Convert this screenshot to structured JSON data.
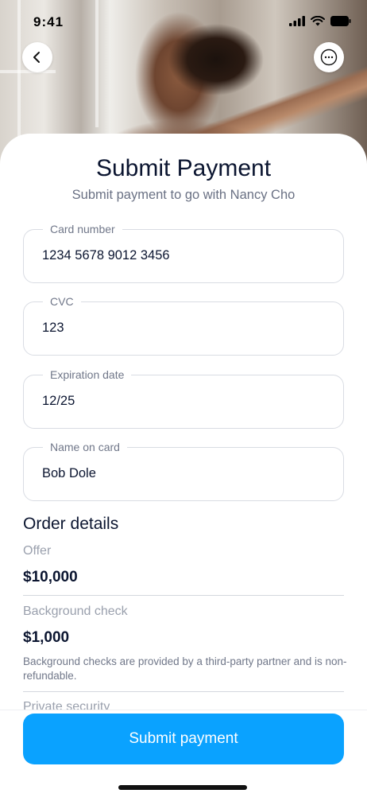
{
  "status_bar": {
    "time": "9:41"
  },
  "header": {
    "back_icon": "chevron-left-icon",
    "more_icon": "more-horizontal-icon"
  },
  "page": {
    "title": "Submit Payment",
    "subtitle": "Submit payment to go with Nancy Cho"
  },
  "form": {
    "card_number": {
      "label": "Card number",
      "value": "1234 5678 9012 3456"
    },
    "cvc": {
      "label": "CVC",
      "value": "123"
    },
    "expiration": {
      "label": "Expiration date",
      "value": "12/25"
    },
    "name": {
      "label": "Name on card",
      "value": "Bob Dole"
    }
  },
  "order": {
    "title": "Order details",
    "offer": {
      "label": "Offer",
      "value": "$10,000"
    },
    "background_check": {
      "label": "Background check",
      "value": "$1,000",
      "note": "Background checks are provided by a third-party partner and is non-refundable."
    },
    "private_security": {
      "label": "Private security"
    }
  },
  "footer": {
    "submit_label": "Submit payment"
  },
  "colors": {
    "accent": "#0aa2ff",
    "text": "#0b1530",
    "muted": "#707789"
  }
}
